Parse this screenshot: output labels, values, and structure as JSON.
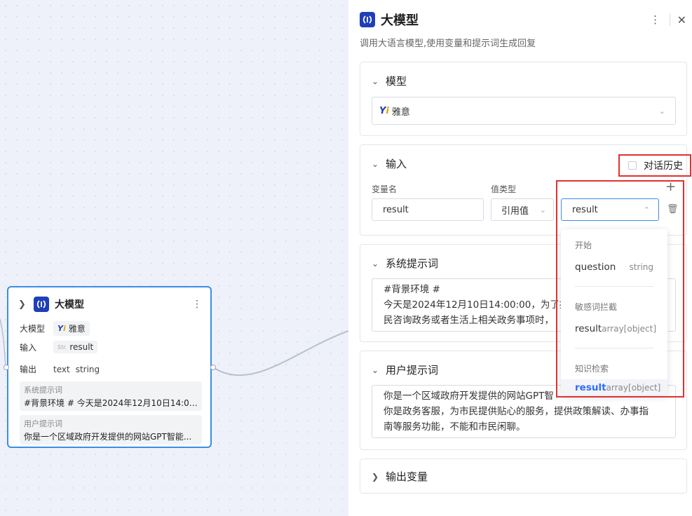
{
  "node": {
    "title": "大模型",
    "rows": {
      "model_label": "大模型",
      "model_value": "雅意",
      "input_label": "输入",
      "input_value": "result",
      "output_label": "输出",
      "output_name": "text",
      "output_type": "string"
    },
    "system_prompt": {
      "label": "系统提示词",
      "preview": "#背景环境 # 今天是2024年12月10日14:00:0..."
    },
    "user_prompt": {
      "label": "用户提示词",
      "preview": "你是一个区域政府开发提供的网站GPT智能..."
    }
  },
  "panel": {
    "title": "大模型",
    "description": "调用大语言模型,使用变量和提示词生成回复",
    "model_section": {
      "title": "模型",
      "selected": "雅意"
    },
    "input_section": {
      "title": "输入",
      "history_checkbox": "对话历史",
      "col_var": "变量名",
      "col_type": "值类型",
      "var_value": "result",
      "type_value": "引用值",
      "ref_value": "result"
    },
    "system_section": {
      "title": "系统提示词",
      "lines": [
        "#背景环境 #",
        "今天是2024年12月10日14:00:00，为了提",
        "民咨询政务或者生活上相关政务事项时，"
      ]
    },
    "user_section": {
      "title": "用户提示词",
      "lines": [
        "你是一个区域政府开发提供的网站GPT智",
        "你是政务客服，为市民提供贴心的服务，提供政策解读、办事指",
        "南等服务功能，不能和市民闲聊。"
      ]
    },
    "output_section": {
      "title": "输出变量"
    }
  },
  "dropdown": {
    "groups": [
      {
        "label": "开始",
        "items": [
          {
            "name": "question",
            "type": "string"
          }
        ]
      },
      {
        "label": "敏感词拦截",
        "items": [
          {
            "name": "result",
            "type": "array[object]"
          }
        ]
      },
      {
        "label": "知识检索",
        "items": [
          {
            "name": "result",
            "type": "array[object]"
          }
        ]
      }
    ]
  },
  "icons": {
    "logo": "model-logo-icon",
    "yi_logo": "yi-logo-icon"
  },
  "colors": {
    "accent": "#3a8ee6",
    "highlight": "#e03131",
    "selected": "#2f6bff",
    "logo_bg": "#1f3fb8"
  }
}
